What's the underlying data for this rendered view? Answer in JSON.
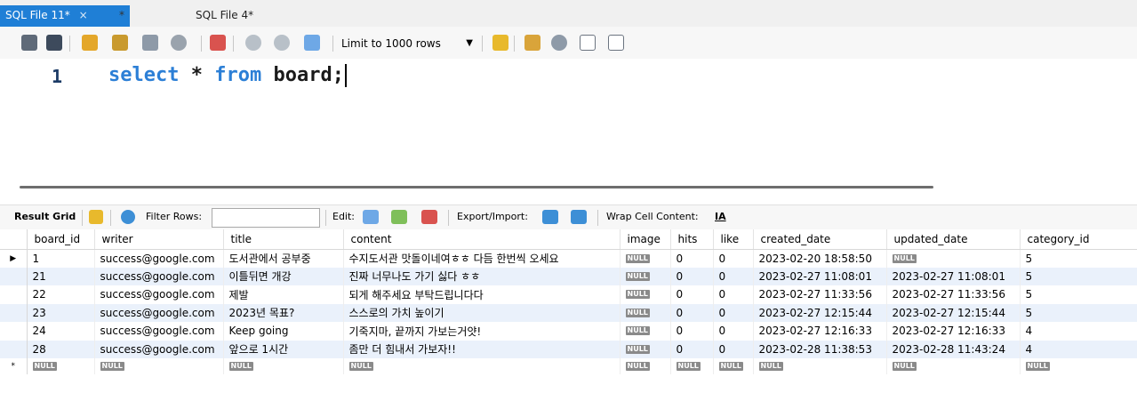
{
  "tabs": [
    {
      "label": "SQL File 11*",
      "close": "×"
    },
    {
      "label": "*"
    },
    {
      "label": "SQL File 4*"
    }
  ],
  "toolbar": {
    "limit_label": "Limit to 1000 rows",
    "icons": [
      "open-folder-icon",
      "save-icon",
      "execute-icon",
      "execute-current-icon",
      "explain-icon",
      "stop-icon",
      "toggle-error-icon",
      "commit-icon",
      "rollback-icon",
      "autocommit-icon",
      "bookmark-icon",
      "beautify-icon",
      "find-icon",
      "invisible-chars-icon",
      "wrap-icon"
    ]
  },
  "editor": {
    "line_number": "1",
    "kw1": "select",
    "sp1": " * ",
    "kw2": "from",
    "sp2": " board;"
  },
  "result_toolbar": {
    "result_grid": "Result Grid",
    "filter_rows": "Filter Rows:",
    "edit": "Edit:",
    "export_import": "Export/Import:",
    "wrap_cell": "Wrap Cell Content:",
    "wrap_icon_text": "IA"
  },
  "grid": {
    "columns": [
      "board_id",
      "writer",
      "title",
      "content",
      "image",
      "hits",
      "like",
      "created_date",
      "updated_date",
      "category_id"
    ],
    "null_label": "NULL",
    "rows": [
      {
        "board_id": "1",
        "writer": "success@google.com",
        "title": "도서관에서 공부중",
        "content": "수지도서관 맛돌이네여ㅎㅎ 다듬 한번씩 오세요",
        "image": "NULL",
        "hits": "0",
        "like": "0",
        "created_date": "2023-02-20 18:58:50",
        "updated_date": "NULL",
        "category_id": "5"
      },
      {
        "board_id": "21",
        "writer": "success@google.com",
        "title": "이틀뒤면 개강",
        "content": "진짜 너무나도 가기 싫다 ㅎㅎ",
        "image": "NULL",
        "hits": "0",
        "like": "0",
        "created_date": "2023-02-27 11:08:01",
        "updated_date": "2023-02-27 11:08:01",
        "category_id": "5"
      },
      {
        "board_id": "22",
        "writer": "success@google.com",
        "title": "제발",
        "content": "되게 해주세요 부탁드립니다다",
        "image": "NULL",
        "hits": "0",
        "like": "0",
        "created_date": "2023-02-27 11:33:56",
        "updated_date": "2023-02-27 11:33:56",
        "category_id": "5"
      },
      {
        "board_id": "23",
        "writer": "success@google.com",
        "title": "2023년 목표?",
        "content": "스스로의 가치 높이기",
        "image": "NULL",
        "hits": "0",
        "like": "0",
        "created_date": "2023-02-27 12:15:44",
        "updated_date": "2023-02-27 12:15:44",
        "category_id": "5"
      },
      {
        "board_id": "24",
        "writer": "success@google.com",
        "title": "Keep going",
        "content": "기죽지마, 끝까지 가보는거얏!",
        "image": "NULL",
        "hits": "0",
        "like": "0",
        "created_date": "2023-02-27 12:16:33",
        "updated_date": "2023-02-27 12:16:33",
        "category_id": "4"
      },
      {
        "board_id": "28",
        "writer": "success@google.com",
        "title": "앞으로 1시간",
        "content": "좀만 더 힘내서 가보자!!",
        "image": "NULL",
        "hits": "0",
        "like": "0",
        "created_date": "2023-02-28 11:38:53",
        "updated_date": "2023-02-28 11:43:24",
        "category_id": "4"
      }
    ],
    "current_row_marker": "▶",
    "new_row_marker": "*"
  },
  "colors": {
    "tab_active": "#1f7fd6",
    "keyword": "#2c7fd6",
    "alt_row": "#eaf1fb"
  }
}
